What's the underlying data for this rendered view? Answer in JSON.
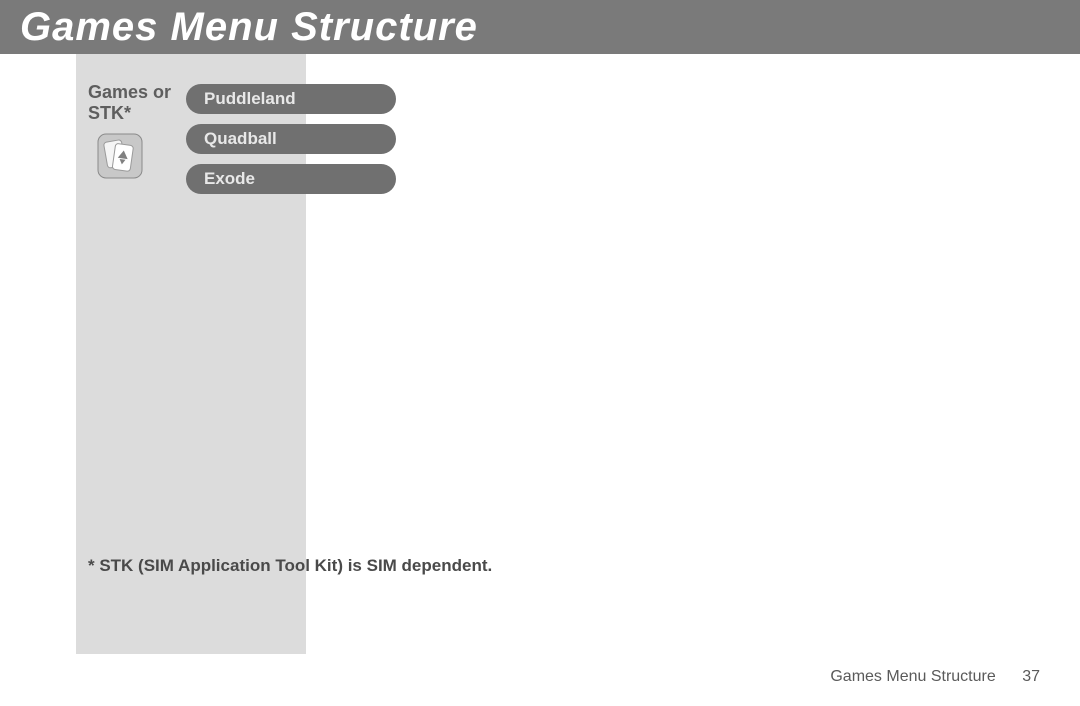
{
  "header": {
    "title": "Games Menu Structure"
  },
  "menu": {
    "label": "Games or STK*",
    "items": [
      "Puddleland",
      "Quadball",
      "Exode"
    ]
  },
  "footnote": "* STK (SIM Application Tool Kit) is SIM dependent.",
  "footer": {
    "section": "Games Menu Structure",
    "page": "37"
  }
}
